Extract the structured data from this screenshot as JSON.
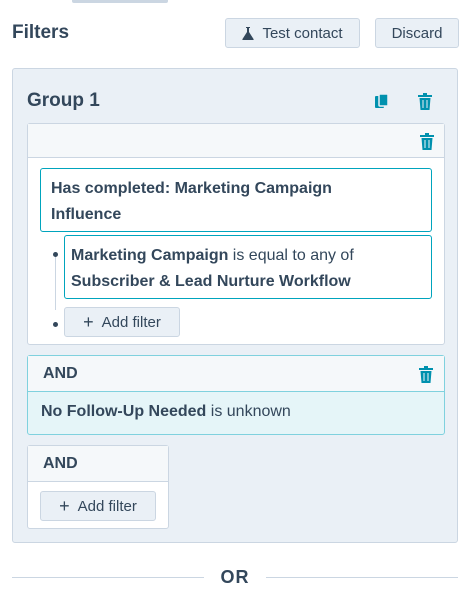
{
  "header": {
    "title": "Filters",
    "test_contact_label": "Test contact",
    "discard_label": "Discard"
  },
  "group": {
    "title": "Group 1",
    "event_filter": {
      "text_line1": "Has completed: Marketing Campaign",
      "text_line2": "Influence"
    },
    "property_filter": {
      "property": "Marketing Campaign",
      "operator": " is equal to any of",
      "value": "Subscriber & Lead Nurture Workflow"
    },
    "add_filter_label": "Add filter",
    "and_block": {
      "label": "AND",
      "property": "No Follow-Up Needed",
      "operator": " is unknown"
    },
    "and_block2": {
      "label": "AND",
      "add_filter_label": "Add filter"
    }
  },
  "or_divider": "OR",
  "icons": {
    "flask": "flask-icon",
    "copy": "copy-icon",
    "trash": "trash-icon",
    "plus": "plus-icon"
  },
  "colors": {
    "text": "#33475b",
    "accent_teal": "#00a4bd",
    "trash_teal": "#0091ae",
    "panel_bg": "#eaf0f6",
    "and_bg": "#e5f5f8"
  }
}
